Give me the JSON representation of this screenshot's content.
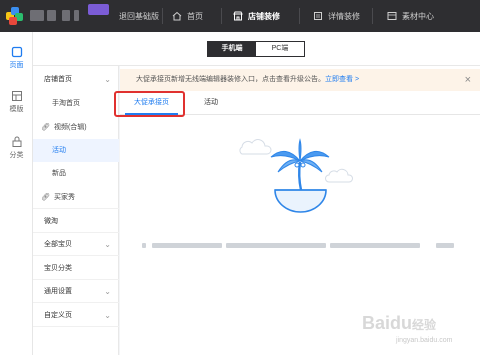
{
  "topbar": {
    "back_label": "退回基础版",
    "nav": [
      {
        "label": "首页",
        "icon": "home-icon"
      },
      {
        "label": "店铺装修",
        "icon": "shop-icon",
        "active": true
      },
      {
        "label": "详情装修",
        "icon": "detail-icon"
      },
      {
        "label": "素材中心",
        "icon": "material-icon"
      }
    ]
  },
  "leftrail": {
    "items": [
      {
        "label": "页面",
        "icon": "page-icon",
        "active": true
      },
      {
        "label": "模版",
        "icon": "template-icon"
      },
      {
        "label": "分类",
        "icon": "category-icon"
      }
    ]
  },
  "device_switch": {
    "mobile": "手机端",
    "pc": "PC端",
    "selected": "mobile"
  },
  "sidemenu": {
    "items": [
      {
        "label": "店铺首页",
        "type": "head",
        "chevron": true
      },
      {
        "label": "手淘首页",
        "type": "sub"
      },
      {
        "label": "视频(合辑)",
        "type": "sub-icon",
        "icon": "link-icon"
      },
      {
        "label": "活动",
        "type": "sub",
        "selected": true
      },
      {
        "label": "新品",
        "type": "sub"
      },
      {
        "label": "买家秀",
        "type": "sub-icon",
        "icon": "link-icon"
      },
      {
        "label": "微淘",
        "type": "item"
      },
      {
        "label": "全部宝贝",
        "type": "item",
        "chevron": true
      },
      {
        "label": "宝贝分类",
        "type": "item"
      },
      {
        "label": "通用设置",
        "type": "item",
        "chevron": true
      },
      {
        "label": "自定义页",
        "type": "item",
        "chevron": true
      }
    ]
  },
  "notice": {
    "text": "大促承接页新增无线端编辑器装修入口，点击查看升级公告。",
    "link": "立即查看 >"
  },
  "tabs": [
    {
      "label": "大促承接页",
      "active": true
    },
    {
      "label": "活动"
    }
  ],
  "colors": {
    "accent": "#1f7cf0",
    "highlight": "#e0312f",
    "topbar": "#2e2e31"
  },
  "watermark": {
    "brand": "Baidu",
    "suffix": "经验",
    "url": "jingyan.baidu.com"
  }
}
